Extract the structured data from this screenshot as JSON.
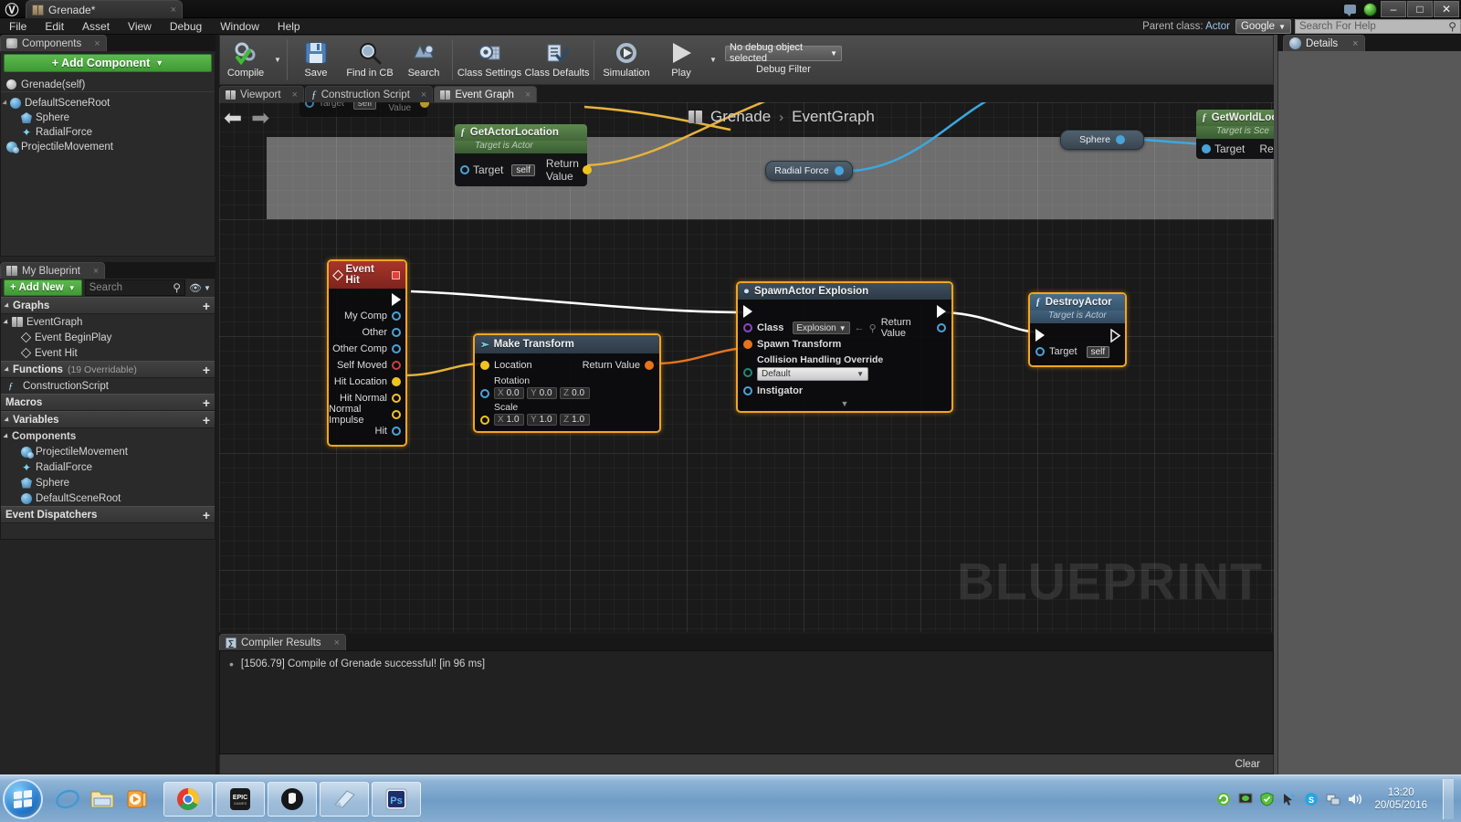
{
  "window": {
    "asset_tab_title": "Grenade*",
    "asset_tab_close": "×",
    "minimize": "–",
    "maximize": "□",
    "close": "✕"
  },
  "menu": {
    "items": [
      "File",
      "Edit",
      "Asset",
      "View",
      "Debug",
      "Window",
      "Help"
    ],
    "parent_class_label": "Parent class:",
    "parent_class_value": "Actor",
    "search_provider": "Google",
    "help_search_placeholder": "Search For Help"
  },
  "toolbar": {
    "items": [
      {
        "label": "Compile",
        "icon": "compile-icon"
      },
      {
        "label": "Save",
        "icon": "save-icon"
      },
      {
        "label": "Find in CB",
        "icon": "find-in-content-browser-icon"
      },
      {
        "label": "Search",
        "icon": "search-icon"
      },
      {
        "label": "Class Settings",
        "icon": "class-settings-icon"
      },
      {
        "label": "Class Defaults",
        "icon": "class-defaults-icon"
      },
      {
        "label": "Simulation",
        "icon": "simulation-icon"
      },
      {
        "label": "Play",
        "icon": "play-icon"
      }
    ],
    "debug_object": "No debug object selected",
    "debug_filter_label": "Debug Filter"
  },
  "components_panel": {
    "tab_label": "Components",
    "tab_close": "×",
    "add_component_label": "+ Add Component",
    "tree": [
      {
        "label": "Grenade(self)",
        "icon": "actor-root-icon",
        "depth": 0
      },
      {
        "label": "DefaultSceneRoot",
        "icon": "scene-root-icon",
        "depth": 0
      },
      {
        "label": "Sphere",
        "icon": "sphere-icon",
        "depth": 1
      },
      {
        "label": "RadialForce",
        "icon": "radial-force-icon",
        "depth": 1
      },
      {
        "label": "ProjectileMovement",
        "icon": "projectile-movement-icon",
        "depth": 0
      }
    ]
  },
  "my_blueprint_panel": {
    "tab_label": "My Blueprint",
    "tab_close": "×",
    "add_new_label": "+ Add New",
    "search_placeholder": "Search",
    "sections": [
      {
        "name": "Graphs",
        "count": "",
        "items": [
          {
            "label": "EventGraph",
            "icon": "event-graph-icon",
            "depth": 0
          },
          {
            "label": "Event BeginPlay",
            "icon": "event-node-icon",
            "depth": 1
          },
          {
            "label": "Event Hit",
            "icon": "event-node-icon",
            "depth": 1
          }
        ]
      },
      {
        "name": "Functions",
        "count": "(19 Overridable)",
        "items": [
          {
            "label": "ConstructionScript",
            "icon": "function-icon",
            "depth": 0
          }
        ]
      },
      {
        "name": "Macros",
        "count": "",
        "items": []
      },
      {
        "name": "Variables",
        "count": "",
        "items": []
      },
      {
        "name": "Components",
        "count": "",
        "is_sub": true,
        "items": [
          {
            "label": "ProjectileMovement",
            "icon": "projectile-movement-icon",
            "depth": 1
          },
          {
            "label": "RadialForce",
            "icon": "radial-force-icon",
            "depth": 1
          },
          {
            "label": "Sphere",
            "icon": "sphere-icon",
            "depth": 1
          },
          {
            "label": "DefaultSceneRoot",
            "icon": "scene-root-icon",
            "depth": 1
          }
        ]
      },
      {
        "name": "Event Dispatchers",
        "count": "",
        "items": []
      }
    ]
  },
  "graph_tabs": [
    {
      "label": "Viewport",
      "icon": "viewport-icon",
      "active": false,
      "close": "×"
    },
    {
      "label": "Construction Script",
      "icon": "function-icon",
      "active": false,
      "close": "×"
    },
    {
      "label": "Event Graph",
      "icon": "event-graph-icon",
      "active": true,
      "close": "×"
    }
  ],
  "graph": {
    "breadcrumb": {
      "root": "Grenade",
      "separator": "›",
      "leaf": "EventGraph"
    },
    "watermark": "BLUEPRINT",
    "nav_back": "←",
    "nav_forward": "→",
    "nodes": {
      "get_actor_location": {
        "title": "GetActorLocation",
        "subtitle": "Target is Actor",
        "target_label": "Target",
        "target_value": "self",
        "return_label": "Return Value"
      },
      "get_world_location": {
        "title": "GetWorldLocatio",
        "subtitle": "Target is Sce",
        "target_label": "Target",
        "return_label": "Ret"
      },
      "radial_force_pill": {
        "label": "Radial Force"
      },
      "sphere_pill": {
        "label": "Sphere"
      },
      "event_hit": {
        "title": "Event Hit",
        "pins": [
          {
            "label": "My Comp",
            "type": "object"
          },
          {
            "label": "Other",
            "type": "object"
          },
          {
            "label": "Other Comp",
            "type": "object"
          },
          {
            "label": "Self Moved",
            "type": "bool"
          },
          {
            "label": "Hit Location",
            "type": "vector"
          },
          {
            "label": "Hit Normal",
            "type": "vector-o"
          },
          {
            "label": "Normal Impulse",
            "type": "vector-o"
          },
          {
            "label": "Hit",
            "type": "struct"
          }
        ]
      },
      "make_transform": {
        "title": "Make Transform",
        "location_label": "Location",
        "rotation_label": "Rotation",
        "scale_label": "Scale",
        "return_label": "Return Value",
        "rotation": {
          "x": "0.0",
          "y": "0.0",
          "z": "0.0"
        },
        "scale": {
          "x": "1.0",
          "y": "1.0",
          "z": "1.0"
        },
        "axis_x": "X",
        "axis_y": "Y",
        "axis_z": "Z"
      },
      "spawn_actor": {
        "title": "SpawnActor Explosion",
        "class_label": "Class",
        "class_value": "Explosion",
        "spawn_transform_label": "Spawn Transform",
        "collision_label": "Collision Handling Override",
        "collision_value": "Default",
        "instigator_label": "Instigator",
        "return_label": "Return Value",
        "expand_glyph": "▼"
      },
      "destroy_actor": {
        "title": "DestroyActor",
        "subtitle": "Target is Actor",
        "target_label": "Target",
        "target_value": "self"
      }
    }
  },
  "compiler_results": {
    "tab_label": "Compiler Results",
    "tab_close": "×",
    "messages": [
      "[1506.79] Compile of Grenade successful! [in 96 ms]"
    ],
    "clear_label": "Clear"
  },
  "details_panel": {
    "tab_label": "Details",
    "tab_close": "×"
  },
  "taskbar": {
    "quick_launch": [
      {
        "name": "internet-explorer-icon",
        "glyph": "e"
      },
      {
        "name": "file-explorer-icon",
        "glyph": "🗀"
      },
      {
        "name": "media-player-icon",
        "glyph": "▶"
      }
    ],
    "tasks": [
      {
        "name": "chrome-taskbar-button",
        "glyph": "●"
      },
      {
        "name": "epic-games-launcher-taskbar-button",
        "glyph": "EPIC"
      },
      {
        "name": "unreal-engine-taskbar-button",
        "glyph": "Ⓤ"
      },
      {
        "name": "notepad-taskbar-button",
        "glyph": "◱"
      },
      {
        "name": "photoshop-taskbar-button",
        "glyph": "Ps"
      }
    ],
    "tray": [
      {
        "name": "nvidia-tray-icon",
        "glyph": "⟳"
      },
      {
        "name": "display-tray-icon",
        "glyph": "▭"
      },
      {
        "name": "shield-tray-icon",
        "glyph": "⛨"
      },
      {
        "name": "mouse-tray-icon",
        "glyph": "✒"
      },
      {
        "name": "skype-tray-icon",
        "glyph": "S"
      },
      {
        "name": "network-tray-icon",
        "glyph": "❐"
      },
      {
        "name": "volume-tray-icon",
        "glyph": "🔊"
      }
    ],
    "clock_time": "13:20",
    "clock_date": "20/05/2016"
  },
  "colors": {
    "accent_green": "#4ea33f",
    "selection_orange": "#f0a622",
    "exec_wire": "#ffffff",
    "vector_wire": "#f0c420",
    "object_wire": "#4aa3d8",
    "transform_wire": "#e8741a",
    "event_header": "#a03028",
    "function_header": "#3a6a8f",
    "pure_function_header": "#4a7a3a"
  }
}
